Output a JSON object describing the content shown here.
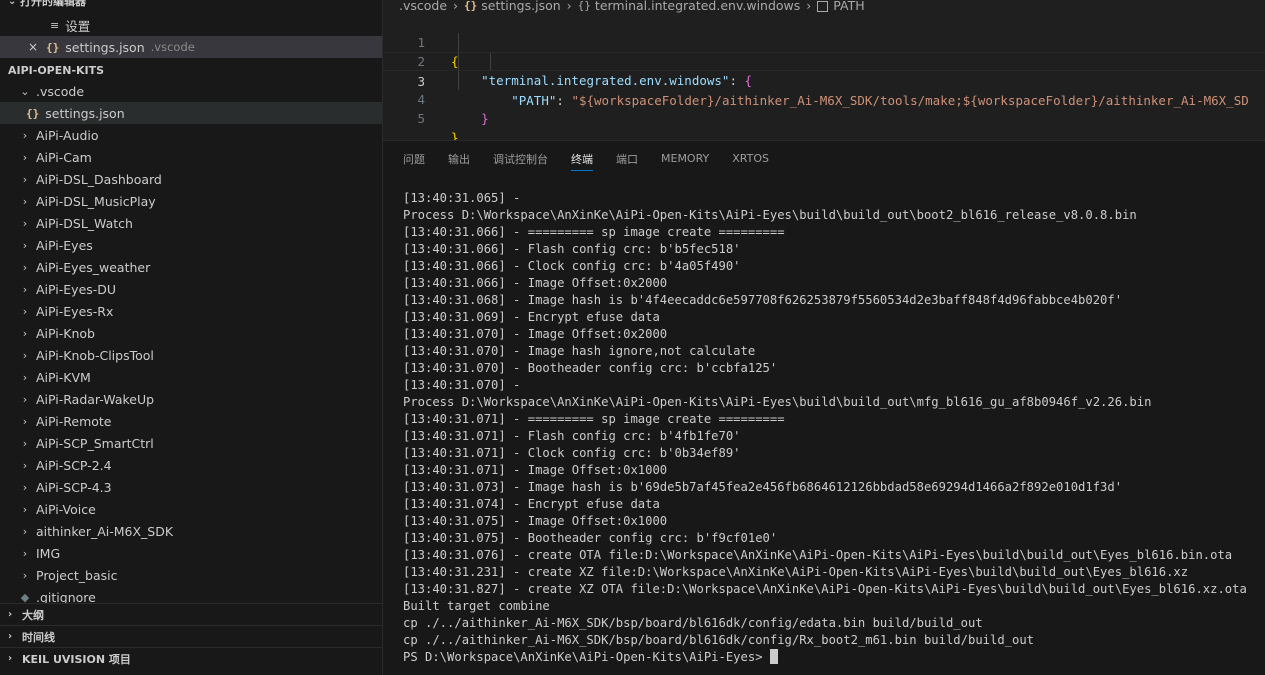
{
  "sidebar": {
    "open_editors_title": "打开的编辑器",
    "open_editors": [
      {
        "label": "设置",
        "suffix": ""
      },
      {
        "label": "settings.json",
        "suffix": ".vscode"
      }
    ],
    "workspace_title": "AIPI-OPEN-KITS",
    "tree": {
      "vscode_folder": ".vscode",
      "settings_file": "settings.json",
      "folders": [
        "AiPi-Audio",
        "AiPi-Cam",
        "AiPi-DSL_Dashboard",
        "AiPi-DSL_MusicPlay",
        "AiPi-DSL_Watch",
        "AiPi-Eyes",
        "AiPi-Eyes_weather",
        "AiPi-Eyes-DU",
        "AiPi-Eyes-Rx",
        "AiPi-Knob",
        "AiPi-Knob-ClipsTool",
        "AiPi-KVM",
        "AiPi-Radar-WakeUp",
        "AiPi-Remote",
        "AiPi-SCP_SmartCtrl",
        "AiPi-SCP-2.4",
        "AiPi-SCP-4.3",
        "AiPi-Voice",
        "aithinker_Ai-M6X_SDK",
        "IMG",
        "Project_basic"
      ],
      "gitignore": ".gitignore"
    },
    "outline_title": "大纲",
    "timeline_title": "时间线",
    "keil_title": "KEIL UVISION 项目"
  },
  "editor": {
    "breadcrumb": [
      ".vscode",
      "settings.json",
      "terminal.integrated.env.windows",
      "PATH"
    ],
    "lines": [
      {
        "n": "1"
      },
      {
        "n": "2",
        "key": "\"terminal.integrated.env.windows\""
      },
      {
        "n": "3",
        "key": "\"PATH\"",
        "value": "\"${workspaceFolder}/aithinker_Ai-M6X_SDK/tools/make;${workspaceFolder}/aithinker_Ai-M6X_SD"
      },
      {
        "n": "4"
      },
      {
        "n": "5"
      }
    ]
  },
  "panel": {
    "tabs": [
      "问题",
      "输出",
      "调试控制台",
      "终端",
      "端口",
      "MEMORY",
      "XRTOS"
    ],
    "active_tab": "终端",
    "terminal_lines": [
      "[13:40:31.065] -",
      "Process D:\\Workspace\\AnXinKe\\AiPi-Open-Kits\\AiPi-Eyes\\build\\build_out\\boot2_bl616_release_v8.0.8.bin",
      "[13:40:31.066] - ========= sp image create =========",
      "[13:40:31.066] - Flash config crc: b'b5fec518'",
      "[13:40:31.066] - Clock config crc: b'4a05f490'",
      "[13:40:31.066] - Image Offset:0x2000",
      "[13:40:31.068] - Image hash is b'4f4eecaddc6e597708f626253879f5560534d2e3baff848f4d96fabbce4b020f'",
      "[13:40:31.069] - Encrypt efuse data",
      "[13:40:31.070] - Image Offset:0x2000",
      "[13:40:31.070] - Image hash ignore,not calculate",
      "[13:40:31.070] - Bootheader config crc: b'ccbfa125'",
      "[13:40:31.070] -",
      "Process D:\\Workspace\\AnXinKe\\AiPi-Open-Kits\\AiPi-Eyes\\build\\build_out\\mfg_bl616_gu_af8b0946f_v2.26.bin",
      "[13:40:31.071] - ========= sp image create =========",
      "[13:40:31.071] - Flash config crc: b'4fb1fe70'",
      "[13:40:31.071] - Clock config crc: b'0b34ef89'",
      "[13:40:31.071] - Image Offset:0x1000",
      "[13:40:31.073] - Image hash is b'69de5b7af45fea2e456fb6864612126bbdad58e69294d1466a2f892e010d1f3d'",
      "[13:40:31.074] - Encrypt efuse data",
      "[13:40:31.075] - Image Offset:0x1000",
      "[13:40:31.075] - Bootheader config crc: b'f9cf01e0'",
      "[13:40:31.076] - create OTA file:D:\\Workspace\\AnXinKe\\AiPi-Open-Kits\\AiPi-Eyes\\build\\build_out\\Eyes_bl616.bin.ota",
      "[13:40:31.231] - create XZ file:D:\\Workspace\\AnXinKe\\AiPi-Open-Kits\\AiPi-Eyes\\build\\build_out\\Eyes_bl616.xz",
      "[13:40:31.827] - create XZ OTA file:D:\\Workspace\\AnXinKe\\AiPi-Open-Kits\\AiPi-Eyes\\build\\build_out\\Eyes_bl616.xz.ota",
      "Built target combine",
      "cp ./../aithinker_Ai-M6X_SDK/bsp/board/bl616dk/config/edata.bin build/build_out",
      "cp ./../aithinker_Ai-M6X_SDK/bsp/board/bl616dk/config/Rx_boot2_m61.bin build/build_out"
    ],
    "prompt": "PS D:\\Workspace\\AnXinKe\\AiPi-Open-Kits\\AiPi-Eyes> "
  },
  "colors": {
    "json_icon": "#e2c08d",
    "active_tab_underline": "#0078d4",
    "brace_gold": "#ffd700",
    "brace_purple": "#da70d6"
  },
  "icons": {
    "json_file": "{}",
    "settings_file": "≡",
    "close": "×",
    "chevron_right": "›",
    "chevron_down": "⌄"
  }
}
